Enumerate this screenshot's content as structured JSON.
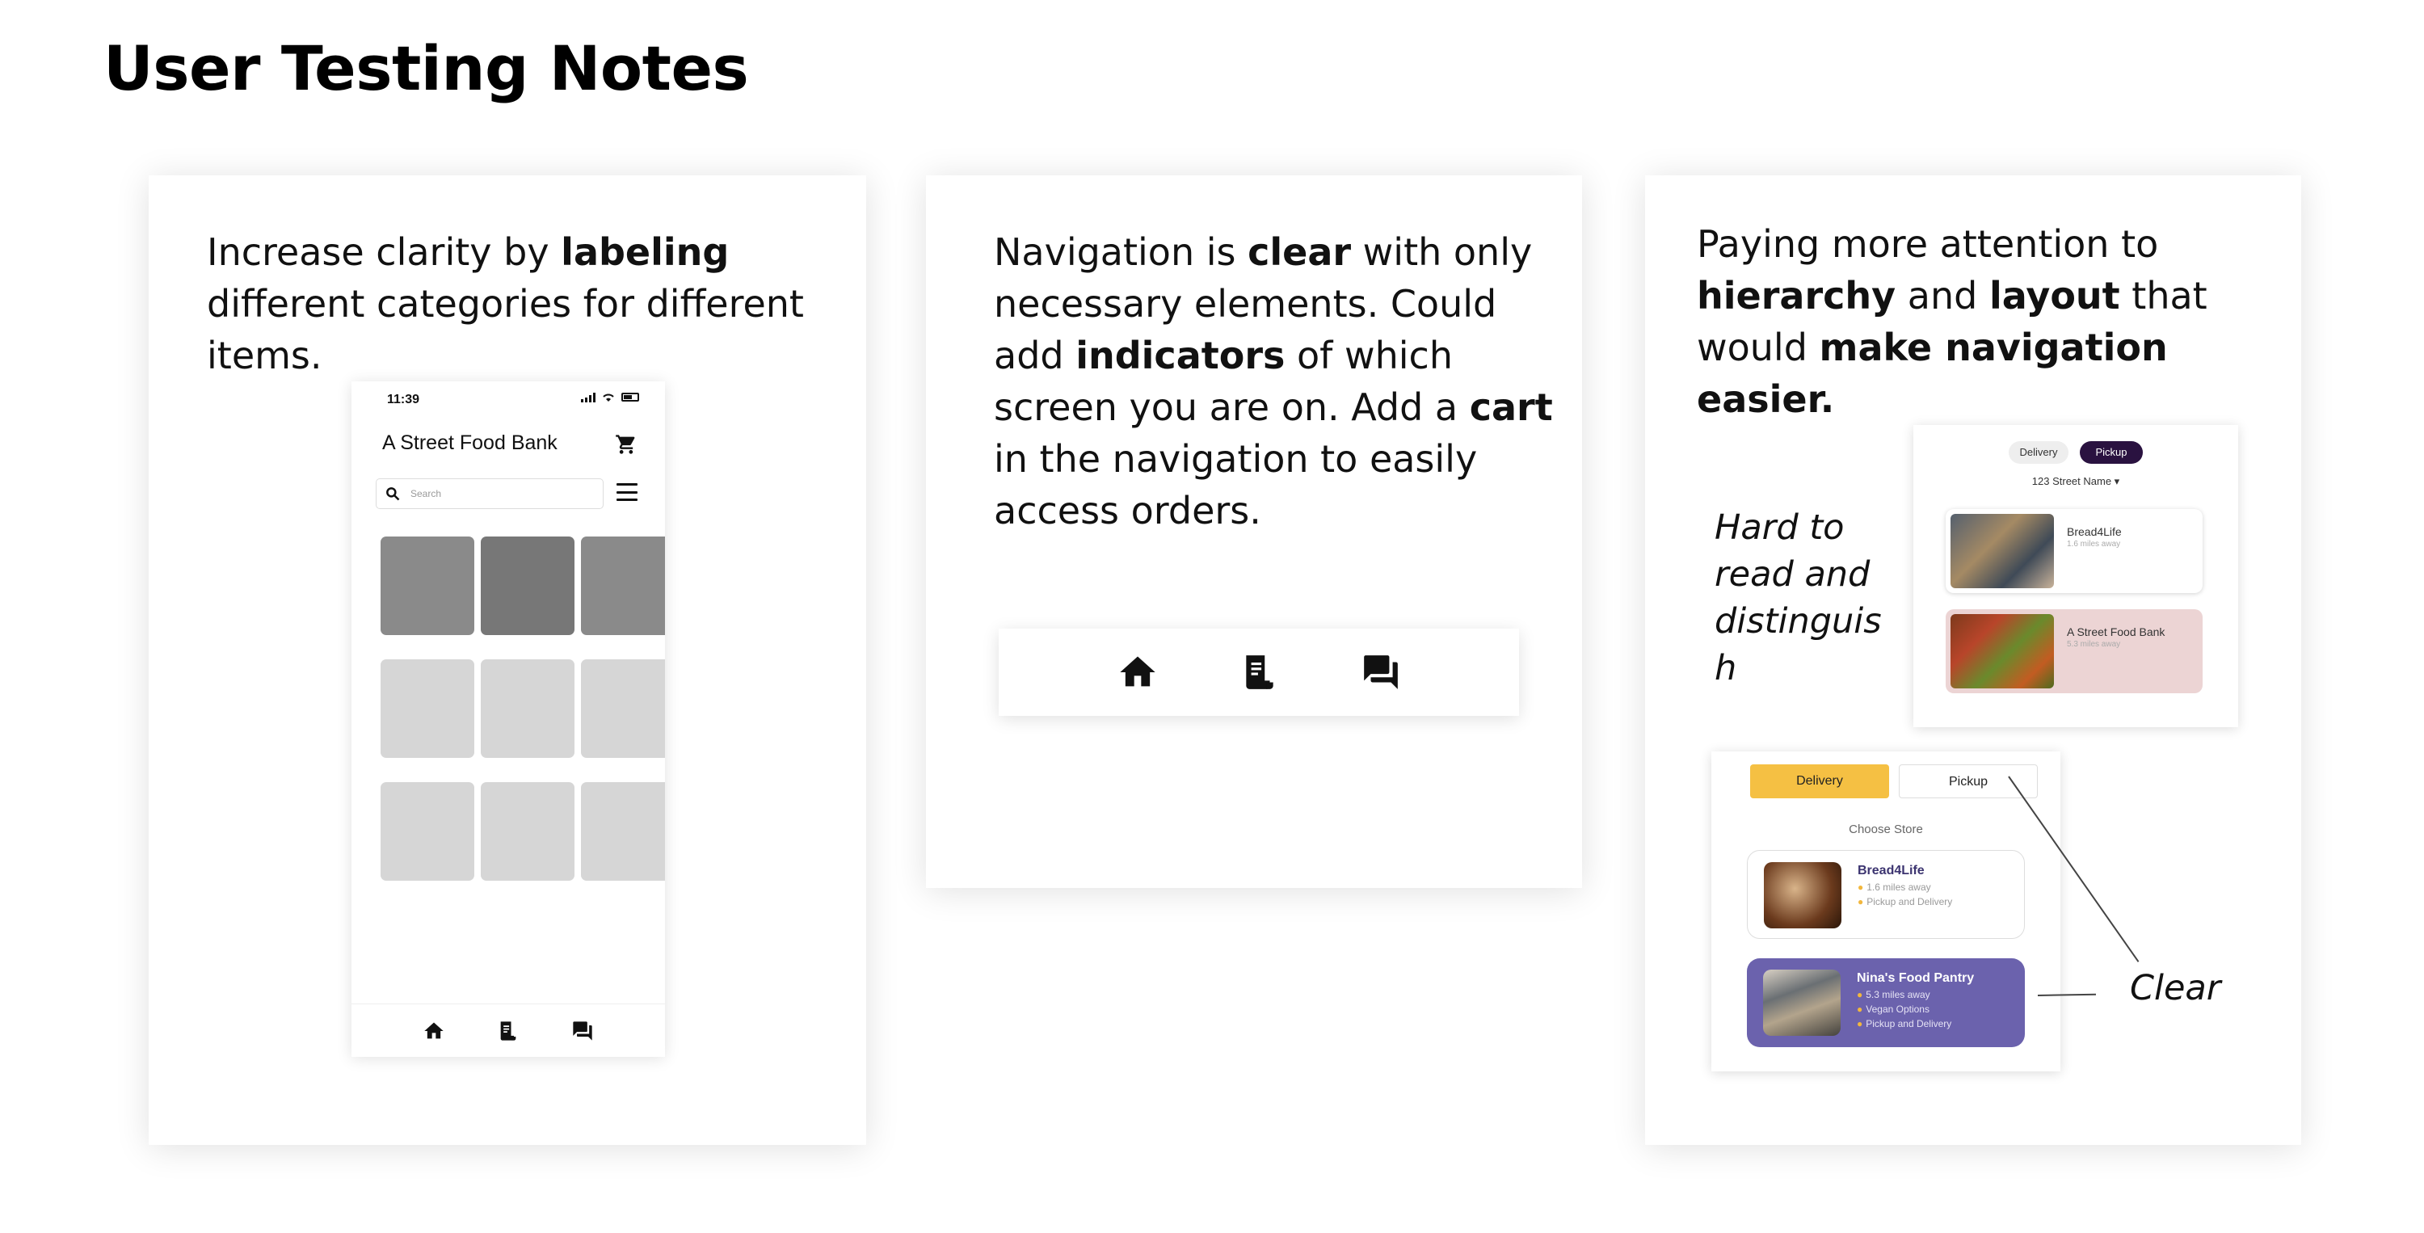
{
  "page": {
    "title": "User Testing Notes"
  },
  "card1": {
    "note_parts": [
      "Increase clarity by ",
      "labeling",
      " different categories for different items."
    ],
    "phone": {
      "time": "11:39",
      "title": "A Street Food Bank",
      "search_placeholder": "Search",
      "tile_colors": [
        "#8a8a8a",
        "#777777",
        "#8a8a8a",
        "#d6d6d6",
        "#d6d6d6",
        "#d6d6d6",
        "#d6d6d6",
        "#d6d6d6",
        "#d6d6d6"
      ],
      "nav_icons": [
        "home-icon",
        "orders-icon",
        "chat-icon"
      ]
    }
  },
  "card2": {
    "note_parts": [
      "Navigation is ",
      "clear",
      " with only necessary elements. Could add ",
      "indicators",
      " of which screen you are on. Add a ",
      "cart",
      " in the navigation to easily access orders."
    ],
    "nav_icons": [
      "home-icon",
      "orders-icon",
      "chat-icon"
    ]
  },
  "card3": {
    "note_parts": [
      "Paying more attention to ",
      "hierarchy",
      " and ",
      "layout",
      " that would ",
      "make navigation easier."
    ],
    "hard_note": "Hard to read and distinguis h",
    "clear_note": "Clear",
    "old_screen": {
      "tabs": [
        "Delivery",
        "Pickup"
      ],
      "address": "123 Street Name",
      "stores": [
        {
          "name": "Bread4Life",
          "distance": "1.6 miles away"
        },
        {
          "name": "A Street Food Bank",
          "distance": "5.3 miles away"
        }
      ],
      "colors": {
        "active_tab": "#2a1240",
        "highlight": "#ecd4d4"
      }
    },
    "new_screen": {
      "tabs": [
        "Delivery",
        "Pickup"
      ],
      "choose_label": "Choose Store",
      "stores": [
        {
          "name": "Bread4Life",
          "details": [
            "1.6 miles away",
            "Pickup and Delivery"
          ]
        },
        {
          "name": "Nina's Food Pantry",
          "details": [
            "5.3 miles away",
            "Vegan Options",
            "Pickup and Delivery"
          ]
        }
      ],
      "colors": {
        "active_tab": "#f5c043",
        "selected_store": "#6b62ad",
        "bullet": "#f2b73d"
      }
    }
  }
}
